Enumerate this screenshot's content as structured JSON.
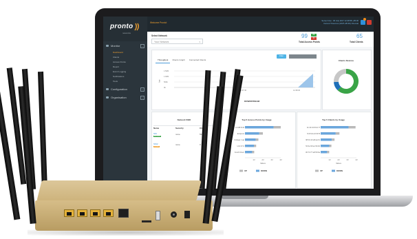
{
  "app": {
    "brand": "pronto",
    "brand_sub": "networks",
    "welcome": "Welcome Pronto!",
    "session_line1": "Server time : 06 July 2017 12:28:58 +05:30",
    "session_line2": "Current Timezone (GMT+05:30) Chennai",
    "notification_count": "5"
  },
  "sidebar": {
    "monitor": "Monitor",
    "sub_items": [
      "Dashboard",
      "Clients",
      "Access Points",
      "Report",
      "Event Logging",
      "Notifications",
      "Tools"
    ],
    "configuration": "Configuration",
    "organization": "Organisation"
  },
  "network_select": {
    "label": "Select Network",
    "value": "Your Network"
  },
  "stats": {
    "access_points_value": "99",
    "access_points_up": "88",
    "access_points_down": "11",
    "access_points_label": "Total Access Points",
    "clients_value": "65",
    "clients_label": "Total Clients"
  },
  "throughput": {
    "tabs": [
      "Throughput",
      "Clients Graph",
      "Connected Clients"
    ],
    "filter_button": "Filter",
    "y_ticks": [
      "1.5Mb",
      "1.0Mb",
      "500k",
      "0k"
    ],
    "y_label": "bps",
    "x_ticks": [
      "12:37:30",
      "12:38:00"
    ],
    "downstream": "DOWNSTREAM"
  },
  "clients_devices": {
    "title": "Clients Devices",
    "segments": [
      {
        "name": "a",
        "value": 0.62,
        "color": "#3aa447"
      },
      {
        "name": "b",
        "value": 0.12,
        "color": "#1f6fb8"
      },
      {
        "name": "c",
        "value": 0.26,
        "color": "#c7c7c7"
      }
    ]
  },
  "ssid_table": {
    "title": "Network SSID",
    "headers": [
      "Name",
      "Security",
      "Cli"
    ],
    "rows": [
      {
        "name": "SSI",
        "badge": "ENABLE",
        "security": "none",
        "clients": "59",
        "badge_color": "#3aa447"
      },
      {
        "name": "SSI2",
        "badge": "DISAB",
        "security": "none",
        "clients": "0",
        "badge_color": "#f0a02f"
      }
    ]
  },
  "top_ap": {
    "title": "Top 5 Access Points by Usage",
    "labels": [
      "1A:4B:8:43",
      "Endpoint",
      "Cottage 1 ap",
      "Unit 07-0",
      "Fourth Floor"
    ],
    "values": [
      800,
      400,
      300,
      250,
      200
    ],
    "x_ticks": [
      "1M",
      "2M",
      "3M",
      "4M"
    ],
    "x_label": "Values",
    "legend": [
      "UP",
      "DOWN"
    ]
  },
  "top_clients": {
    "title": "Top 5 Clients by Usage",
    "labels": [
      "bc:44:34:6f:dc:f7",
      "f4:0f:42:e9:33:f5",
      "98:01:42:a8:aa:6c",
      "54:4e:90:ac:9b:b0",
      "00:73:77:a8:59:9a"
    ],
    "values": [
      780,
      420,
      310,
      240,
      180
    ],
    "x_ticks": [
      "1M",
      "2M",
      "3M",
      "4M"
    ],
    "x_label": "Values",
    "legend": [
      "UP",
      "DOWN"
    ]
  }
}
